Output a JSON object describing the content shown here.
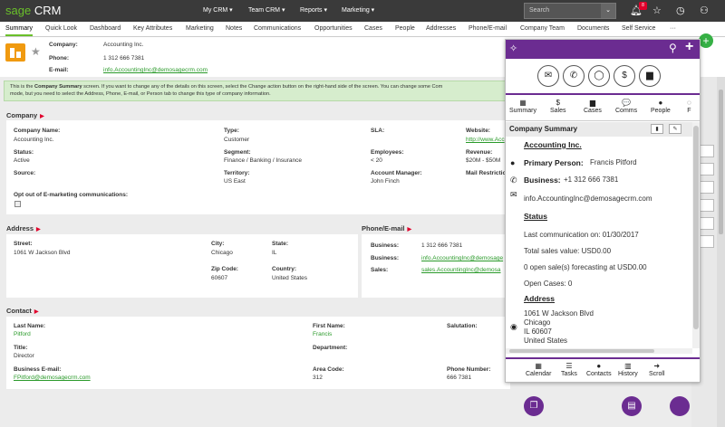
{
  "topbar": {
    "logo_sage": "sage",
    "logo_crm": "CRM",
    "menus": [
      "My CRM ▾",
      "Team CRM ▾",
      "Reports ▾",
      "Marketing ▾"
    ],
    "search_placeholder": "Search",
    "notification_count": "8"
  },
  "tabs": [
    "Summary",
    "Quick Look",
    "Dashboard",
    "Key Attributes",
    "Marketing",
    "Notes",
    "Communications",
    "Opportunities",
    "Cases",
    "People",
    "Addresses",
    "Phone/E-mail",
    "Company Team",
    "Documents",
    "Self Service",
    "···"
  ],
  "header": {
    "company_label": "Company:",
    "company_value": "Accounting Inc.",
    "phone_label": "Phone:",
    "phone_value": "1 312 666 7381",
    "email_label": "E-mail:",
    "email_value": "info.AccountingInc@demosagecrm.com"
  },
  "info_text_1": "This is the ",
  "info_text_bold": "Company Summary",
  "info_text_2": " screen. If you want to change any of the details on this screen, select the Change action button on the right-hand side of the screen. You can change some Com",
  "info_text_3": "mode, but you need to select the Address, Phone, E-mail, or Person tab to change this type of company information.",
  "company_section": {
    "title": "Company",
    "fields": {
      "company_name_label": "Company Name:",
      "company_name_value": "Accounting Inc.",
      "type_label": "Type:",
      "type_value": "Customer",
      "sla_label": "SLA:",
      "website_label": "Website:",
      "website_value": "http://www.Acc",
      "status_label": "Status:",
      "status_value": "Active",
      "segment_label": "Segment:",
      "segment_value": "Finance / Banking / Insurance",
      "employees_label": "Employees:",
      "employees_value": "< 20",
      "revenue_label": "Revenue:",
      "revenue_value": "$20M - $50M",
      "source_label": "Source:",
      "territory_label": "Territory:",
      "territory_value": "US East",
      "account_manager_label": "Account Manager:",
      "account_manager_value": "John Finch",
      "mail_restriction_label": "Mail Restrictio",
      "opt_out_label": "Opt out of E-marketing communications:"
    }
  },
  "address_section": {
    "title": "Address",
    "street_label": "Street:",
    "street_value": "1061 W Jackson Blvd",
    "city_label": "City:",
    "city_value": "Chicago",
    "state_label": "State:",
    "state_value": "IL",
    "zip_label": "Zip Code:",
    "zip_value": "60607",
    "country_label": "Country:",
    "country_value": "United States"
  },
  "phone_section": {
    "title": "Phone/E-mail",
    "business_phone_label": "Business:",
    "business_phone_value": "1 312 666 7381",
    "business_email_label": "Business:",
    "business_email_value": "info.AccountingInc@demosage",
    "sales_label": "Sales:",
    "sales_value": "sales.AccountingInc@demosa"
  },
  "contact_section": {
    "title": "Contact",
    "last_name_label": "Last Name:",
    "last_name_value": "Pitford",
    "first_name_label": "First Name:",
    "first_name_value": "Francis",
    "salutation_label": "Salutation:",
    "title_label": "Title:",
    "title_value": "Director",
    "department_label": "Department:",
    "business_email_label": "Business E-mail:",
    "business_email_value": "FPitford@demosagecrm.com",
    "area_code_label": "Area Code:",
    "area_code_value": "312",
    "phone_number_label": "Phone Number:",
    "phone_number_value": "666 7381"
  },
  "overlay": {
    "nav": [
      {
        "label": "Summary",
        "icon": "▦"
      },
      {
        "label": "Sales",
        "icon": "$"
      },
      {
        "label": "Cases",
        "icon": "▆"
      },
      {
        "label": "Comms",
        "icon": "💬"
      },
      {
        "label": "People",
        "icon": "●"
      },
      {
        "label": "F",
        "icon": "◌"
      }
    ],
    "summary_title": "Company Summary",
    "company_name": "Accounting Inc.",
    "primary_person_label": "Primary Person:",
    "primary_person_value": "Francis Pitford",
    "business_label": "Business:",
    "business_value": "+1 312 666 7381",
    "email_value": "info.AccountingInc@demosagecrm.com",
    "status_heading": "Status",
    "last_comm": "Last communication on: 01/30/2017",
    "total_sales": "Total sales value: USD0.00",
    "open_sales": "0 open sale(s) forecasting at USD0.00",
    "open_cases": "Open Cases: 0",
    "address_heading": "Address",
    "address_line1": "1061 W Jackson Blvd",
    "address_line2": "Chicago",
    "address_line3": "IL 60607",
    "address_line4": "United States",
    "bottom": [
      {
        "label": "Calendar",
        "icon": "▦"
      },
      {
        "label": "Tasks",
        "icon": "☰"
      },
      {
        "label": "Contacts",
        "icon": "●"
      },
      {
        "label": "History",
        "icon": "▥"
      },
      {
        "label": "Scroll",
        "icon": "➜"
      }
    ]
  }
}
